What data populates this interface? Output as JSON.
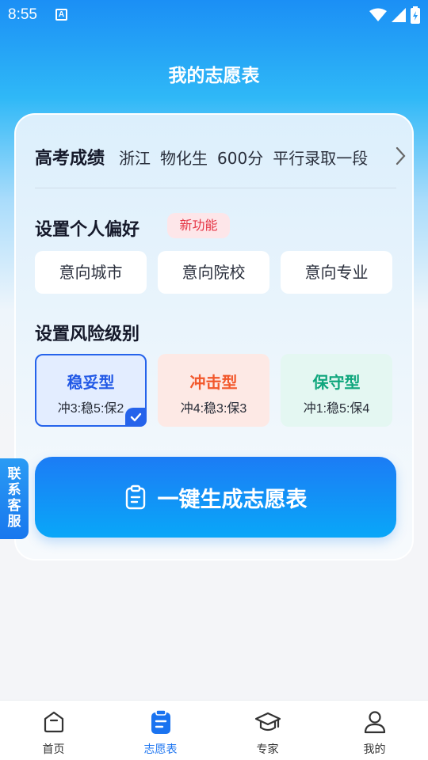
{
  "status_bar": {
    "time": "8:55",
    "notification_glyph": "A"
  },
  "header": {
    "title": "我的志愿表"
  },
  "score": {
    "label": "高考成绩",
    "province": "浙江",
    "subjects": "物化生",
    "points": "600分",
    "batch": "平行录取一段"
  },
  "preferences": {
    "title": "设置个人偏好",
    "badge": "新功能",
    "items": [
      "意向城市",
      "意向院校",
      "意向专业"
    ]
  },
  "risk": {
    "title": "设置风险级别",
    "options": [
      {
        "name": "稳妥型",
        "ratio": "冲3:稳5:保2",
        "selected": true,
        "color": "#2259e6"
      },
      {
        "name": "冲击型",
        "ratio": "冲4:稳3:保3",
        "selected": false,
        "color": "#f2582c"
      },
      {
        "name": "保守型",
        "ratio": "冲1:稳5:保4",
        "selected": false,
        "color": "#0fa67d"
      }
    ]
  },
  "generate": {
    "label": "一键生成志愿表",
    "icon": "clipboard-icon"
  },
  "service_tab": {
    "chars": [
      "联",
      "系",
      "客",
      "服"
    ]
  },
  "tabbar": {
    "active": 1,
    "items": [
      {
        "label": "首页",
        "icon": "home-icon"
      },
      {
        "label": "志愿表",
        "icon": "clipboard-icon"
      },
      {
        "label": "专家",
        "icon": "graduation-cap-icon"
      },
      {
        "label": "我的",
        "icon": "person-icon"
      }
    ]
  },
  "colors": {
    "primary": "#1a73f0",
    "accent_red": "#e53545"
  }
}
